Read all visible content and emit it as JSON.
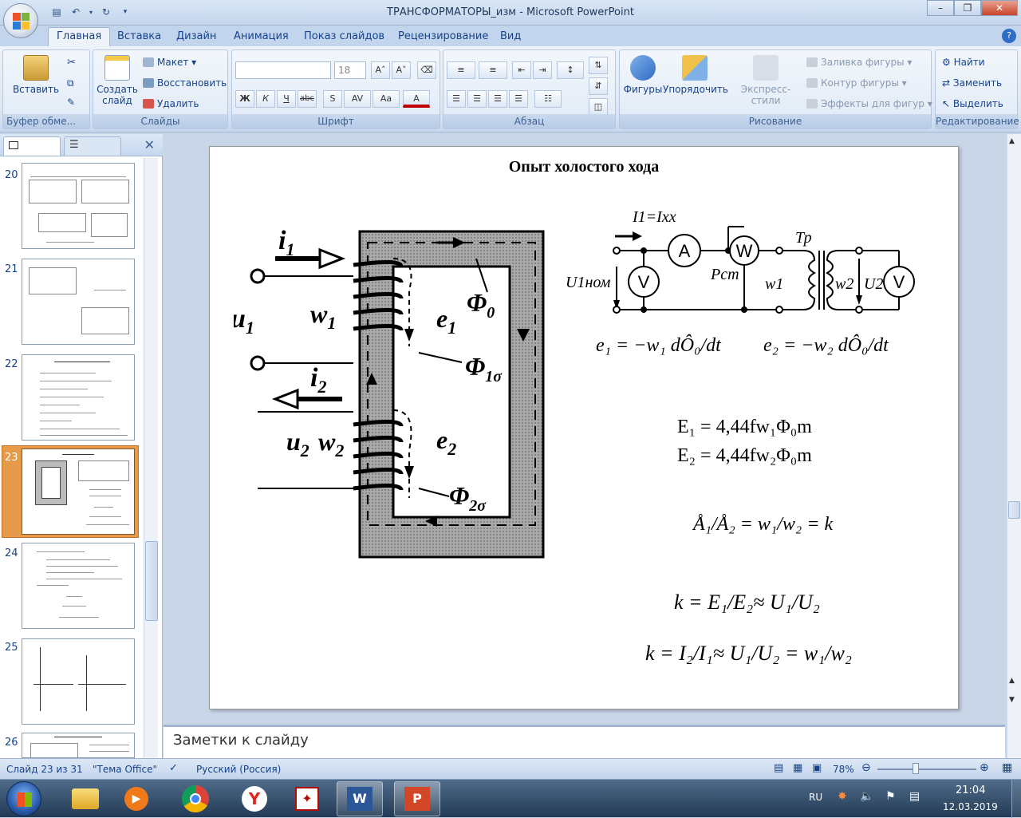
{
  "window": {
    "title": "ТРАНСФОРМАТОРЫ_изм - Microsoft PowerPoint",
    "controls": {
      "minimize": "–",
      "maximize": "❐",
      "close": "✕"
    }
  },
  "ribbon_tabs": [
    "Главная",
    "Вставка",
    "Дизайн",
    "Анимация",
    "Показ слайдов",
    "Рецензирование",
    "Вид"
  ],
  "help": "?",
  "ribbon": {
    "clipboard": {
      "label": "Буфер обме...",
      "paste": "Вставить"
    },
    "slides": {
      "label": "Слайды",
      "new_slide_1": "Создать",
      "new_slide_2": "слайд",
      "layout": "Макет",
      "reset": "Восстановить",
      "delete": "Удалить"
    },
    "font": {
      "label": "Шрифт",
      "size": "18",
      "grow": "A˄",
      "shrink": "A˅",
      "bold": "Ж",
      "italic": "К",
      "underline": "Ч",
      "strike": "abc",
      "shadow": "S",
      "spacing": "AV",
      "case": "Aa",
      "color": "A"
    },
    "paragraph": {
      "label": "Абзац"
    },
    "drawing": {
      "label": "Рисование",
      "shapes": "Фигуры",
      "arrange": "Упорядочить",
      "quick_styles": "Экспресс-стили",
      "fill": "Заливка фигуры",
      "outline": "Контур фигуры",
      "effects": "Эффекты для фигур"
    },
    "editing": {
      "label": "Редактирование",
      "find": "Найти",
      "replace": "Заменить",
      "select": "Выделить"
    }
  },
  "slide_panel": {
    "close": "✕",
    "slides": [
      {
        "num": "20"
      },
      {
        "num": "21"
      },
      {
        "num": "22"
      },
      {
        "num": "23",
        "selected": true
      },
      {
        "num": "24"
      },
      {
        "num": "25"
      },
      {
        "num": "26"
      }
    ]
  },
  "slide": {
    "title": "Опыт холостого хода",
    "diagram": {
      "i1": "i",
      "i1_sub": "1",
      "u1": "u",
      "u1_sub": "1",
      "w1": "w",
      "w1_sub": "1",
      "i2": "i",
      "i2_sub": "2",
      "u2": "u",
      "u2_sub": "2",
      "w2": "w",
      "w2_sub": "2",
      "e1": "e",
      "e1_sub": "1",
      "e2": "e",
      "e2_sub": "2",
      "phi0": "Φ",
      "phi0_sub": "0",
      "phi1s": "Φ",
      "phi1s_sub": "1σ",
      "phi2s": "Φ",
      "phi2s_sub": "2σ"
    },
    "circuit": {
      "current": "I1=Ixx",
      "u1": "U1ном",
      "pst": "Pст",
      "tr": "Тр",
      "w1": "w1",
      "w2": "w2",
      "u2": "U2",
      "ammeter": "A",
      "wattmeter": "W",
      "voltmeter": "V"
    },
    "formulas": {
      "e1": "e₁ = −w₁ dÔ₀/dt",
      "e2": "e₂ = −w₂ dÔ₀/dt",
      "E1": "E₁ = 4,44fw₁Φ₀m",
      "E2": "E₂ = 4,44fw₂Φ₀m",
      "ratio": "Å₁/Å₂ = w₁/w₂ = k",
      "k1": "k = E₁/E₂≈ U₁/U₂",
      "k2": "k = I₂/I₁≈ U₁/U₂ = w₁/w₂"
    }
  },
  "notes": {
    "placeholder": "Заметки к слайду"
  },
  "status": {
    "slide": "Слайд 23 из 31",
    "theme": "\"Тема Office\"",
    "language": "Русский (Россия)",
    "zoom": "78%"
  },
  "taskbar": {
    "lang": "RU",
    "time": "21:04",
    "date": "12.03.2019"
  }
}
